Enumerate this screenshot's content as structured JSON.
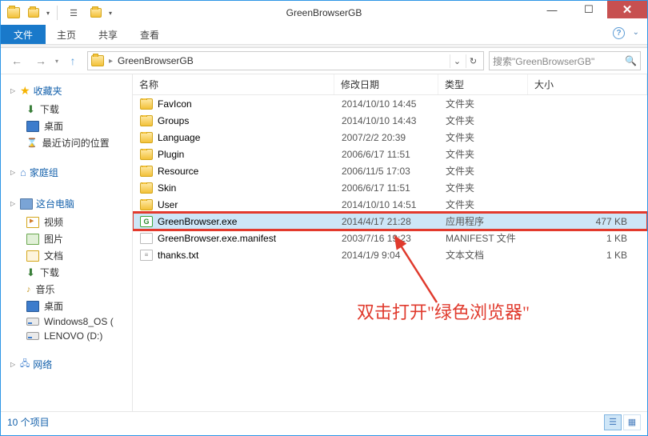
{
  "window": {
    "title": "GreenBrowserGB"
  },
  "ribbon": {
    "file": "文件",
    "tabs": [
      "主页",
      "共享",
      "查看"
    ]
  },
  "nav": {
    "breadcrumb": [
      "GreenBrowserGB"
    ]
  },
  "search": {
    "placeholder": "搜索\"GreenBrowserGB\""
  },
  "sidebar": {
    "favorites": {
      "label": "收藏夹",
      "items": [
        {
          "label": "下载",
          "icon": "download"
        },
        {
          "label": "桌面",
          "icon": "desktop"
        },
        {
          "label": "最近访问的位置",
          "icon": "recent"
        }
      ]
    },
    "homegroup": {
      "label": "家庭组"
    },
    "thispc": {
      "label": "这台电脑",
      "items": [
        {
          "label": "视频",
          "icon": "video"
        },
        {
          "label": "图片",
          "icon": "picture"
        },
        {
          "label": "文档",
          "icon": "doc"
        },
        {
          "label": "下载",
          "icon": "download"
        },
        {
          "label": "音乐",
          "icon": "music"
        },
        {
          "label": "桌面",
          "icon": "desktop"
        },
        {
          "label": "Windows8_OS (",
          "icon": "disk"
        },
        {
          "label": "LENOVO (D:)",
          "icon": "disk"
        }
      ]
    },
    "network": {
      "label": "网络"
    }
  },
  "columns": {
    "name": "名称",
    "date": "修改日期",
    "type": "类型",
    "size": "大小"
  },
  "files": [
    {
      "name": "FavIcon",
      "date": "2014/10/10 14:45",
      "type": "文件夹",
      "size": "",
      "icon": "folder"
    },
    {
      "name": "Groups",
      "date": "2014/10/10 14:43",
      "type": "文件夹",
      "size": "",
      "icon": "folder"
    },
    {
      "name": "Language",
      "date": "2007/2/2 20:39",
      "type": "文件夹",
      "size": "",
      "icon": "folder"
    },
    {
      "name": "Plugin",
      "date": "2006/6/17 11:51",
      "type": "文件夹",
      "size": "",
      "icon": "folder"
    },
    {
      "name": "Resource",
      "date": "2006/11/5 17:03",
      "type": "文件夹",
      "size": "",
      "icon": "folder"
    },
    {
      "name": "Skin",
      "date": "2006/6/17 11:51",
      "type": "文件夹",
      "size": "",
      "icon": "folder"
    },
    {
      "name": "User",
      "date": "2014/10/10 14:51",
      "type": "文件夹",
      "size": "",
      "icon": "folder"
    },
    {
      "name": "GreenBrowser.exe",
      "date": "2014/4/17 21:28",
      "type": "应用程序",
      "size": "477 KB",
      "icon": "exe",
      "selected": true,
      "highlight": true
    },
    {
      "name": "GreenBrowser.exe.manifest",
      "date": "2003/7/16 19:23",
      "type": "MANIFEST 文件",
      "size": "1 KB",
      "icon": "file"
    },
    {
      "name": "thanks.txt",
      "date": "2014/1/9 9:04",
      "type": "文本文档",
      "size": "1 KB",
      "icon": "txt"
    }
  ],
  "status": {
    "count": "10 个项目"
  },
  "annotation": {
    "text": "双击打开\"绿色浏览器\""
  }
}
